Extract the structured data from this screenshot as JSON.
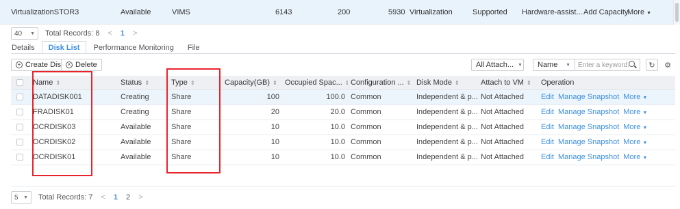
{
  "top_row": {
    "name": "VirtualizationSTOR3",
    "status": "Available",
    "type": "VIMS",
    "capacity": "6143",
    "occupied": "200",
    "free": "5930",
    "category": "Virtualization",
    "support": "Supported",
    "accel": "Hardware-assist...",
    "add_capacity": "Add Capacity",
    "more": "More"
  },
  "pager_top": {
    "page_size": "40",
    "total": "Total Records: 8",
    "pages": [
      "1"
    ],
    "prev": "<",
    "next": ">"
  },
  "tabs": [
    "Details",
    "Disk List",
    "Performance Monitoring",
    "File"
  ],
  "toolbar": {
    "create_label": "Create Disk",
    "delete_label": "Delete",
    "attach_filter": "All Attach...",
    "search_field": "Name",
    "search_placeholder": "Enter a keyword."
  },
  "table": {
    "columns": [
      "Name",
      "Status",
      "Type",
      "Capacity(GB)",
      "Occupied Spac...",
      "Configuration ...",
      "Disk Mode",
      "Attach to VM",
      "Operation"
    ],
    "rows": [
      {
        "name": "DATADISK001",
        "status": "Creating",
        "type": "Share",
        "capacity": "100",
        "occupied": "100.0",
        "config": "Common",
        "mode": "Independent & p...",
        "attach": "Not Attached",
        "edit": "Edit",
        "snapshot": "Manage Snapshot",
        "more": "More"
      },
      {
        "name": "FRADISK01",
        "status": "Creating",
        "type": "Share",
        "capacity": "20",
        "occupied": "20.0",
        "config": "Common",
        "mode": "Independent & p...",
        "attach": "Not Attached",
        "edit": "Edit",
        "snapshot": "Manage Snapshot",
        "more": "More"
      },
      {
        "name": "OCRDISK03",
        "status": "Available",
        "type": "Share",
        "capacity": "10",
        "occupied": "10.0",
        "config": "Common",
        "mode": "Independent & p...",
        "attach": "Not Attached",
        "edit": "Edit",
        "snapshot": "Manage Snapshot",
        "more": "More"
      },
      {
        "name": "OCRDISK02",
        "status": "Available",
        "type": "Share",
        "capacity": "10",
        "occupied": "10.0",
        "config": "Common",
        "mode": "Independent & p...",
        "attach": "Not Attached",
        "edit": "Edit",
        "snapshot": "Manage Snapshot",
        "more": "More"
      },
      {
        "name": "OCRDISK01",
        "status": "Available",
        "type": "Share",
        "capacity": "10",
        "occupied": "10.0",
        "config": "Common",
        "mode": "Independent & p...",
        "attach": "Not Attached",
        "edit": "Edit",
        "snapshot": "Manage Snapshot",
        "more": "More"
      }
    ]
  },
  "pager_bottom": {
    "page_size": "5",
    "total": "Total Records: 7",
    "pages": [
      "1",
      "2"
    ],
    "prev": "<",
    "next": ">"
  },
  "colors": {
    "accent": "#3d8fe0",
    "highlight": "#e8232b",
    "header_bg": "#eef0f3"
  }
}
